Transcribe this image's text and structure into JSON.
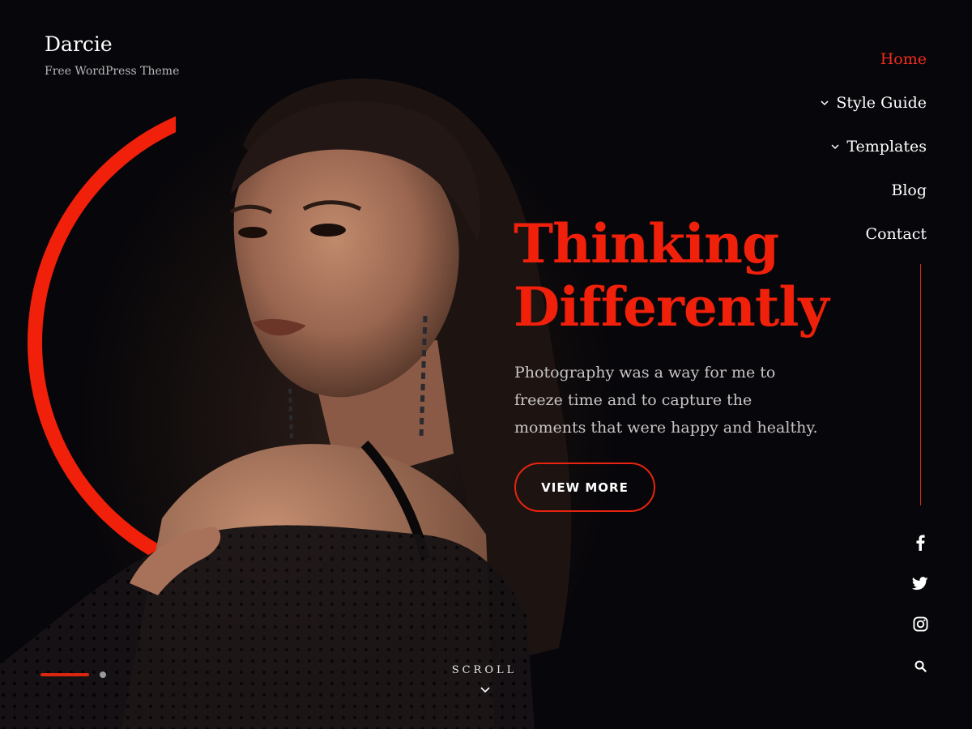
{
  "site": {
    "title": "Darcie",
    "tagline": "Free WordPress Theme"
  },
  "nav": {
    "items": [
      {
        "label": "Home",
        "active": true,
        "has_submenu": false
      },
      {
        "label": "Style Guide",
        "active": false,
        "has_submenu": true
      },
      {
        "label": "Templates",
        "active": false,
        "has_submenu": true
      },
      {
        "label": "Blog",
        "active": false,
        "has_submenu": false
      },
      {
        "label": "Contact",
        "active": false,
        "has_submenu": false
      }
    ]
  },
  "hero": {
    "headline_line1": "Thinking",
    "headline_line2": "Differently",
    "lead": "Photography was a way for me to freeze time and to capture the moments that were happy and healthy.",
    "cta_label": "VIEW MORE"
  },
  "slider": {
    "slide_count": 2,
    "active_slide": 1
  },
  "scroll": {
    "label": "SCROLL"
  },
  "social": {
    "icons": [
      "facebook-icon",
      "twitter-icon",
      "instagram-icon",
      "search-icon"
    ]
  },
  "colors": {
    "accent": "#f1200a",
    "background": "#08070a",
    "text": "#ffffff",
    "muted_text": "#c9c4c4"
  }
}
